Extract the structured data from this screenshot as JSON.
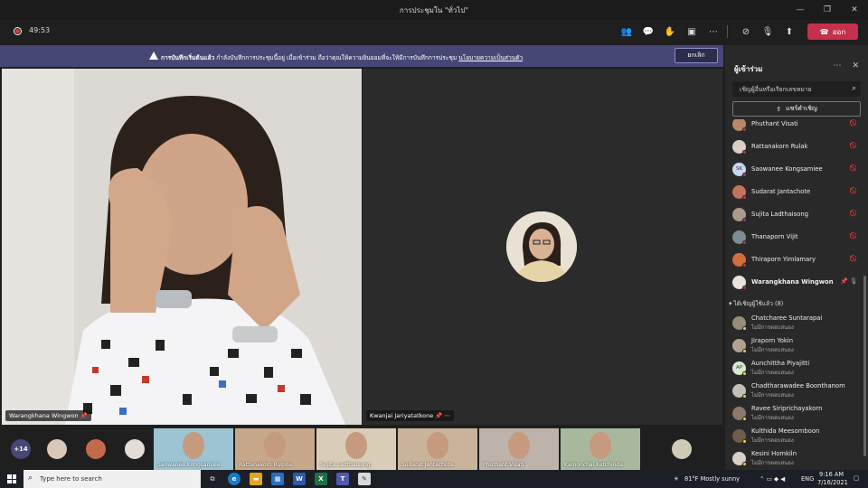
{
  "window": {
    "title": "การประชุมใน \"ทั่วไป\""
  },
  "toolbar": {
    "timer": "49:53",
    "leave_label": "ออก"
  },
  "banner": {
    "bold_text": "การบันทึกเริ่มต้นแล้ว",
    "text": " กำลังบันทึกการประชุมนี้อยู่ เมื่อเข้าร่วม ถือว่าคุณให้ความยินยอมที่จะให้มีการบันทึกการประชุม ",
    "link": "นโยบายความเป็นส่วนตัว",
    "dismiss_label": "ยกเลิก"
  },
  "stage": {
    "left_name": "Warangkhana Wingwon",
    "right_name": "Kwanjai Jariyatatkone"
  },
  "panel": {
    "title": "ผู้เข้าร่วม",
    "search_placeholder": "เชิญผู้อื่นหรือเรียกเลขหมาย",
    "share_label": "แชร์คำเชิญ",
    "participants": [
      {
        "name": "Phuthant Visati",
        "avatar": "#b98866"
      },
      {
        "name": "Rattanakorn Rulak",
        "avatar": "#d8cfc5"
      },
      {
        "name": "Saowanee Kongsamiee",
        "avatar": "#c8d8ef",
        "initials": "SK"
      },
      {
        "name": "Sudarat Jantachote",
        "avatar": "#c2745b"
      },
      {
        "name": "Sujita Ladthaisong",
        "avatar": "#a99a8a"
      },
      {
        "name": "Thanaporn Vijit",
        "avatar": "#7b8c95"
      },
      {
        "name": "Thiraporn Yimlamary",
        "avatar": "#d56e3e"
      },
      {
        "name": "Warangkhana Wingwon",
        "avatar": "#e8e2dc"
      }
    ],
    "invited_header": "ได้เชิญผู้ใช้แล้ว (8)",
    "invited": [
      {
        "name": "Chatcharee Suntarapai",
        "status": "ไม่มีการตอบสนอง",
        "avatar": "#9a8c7c"
      },
      {
        "name": "Jiraporn Yokin",
        "status": "ไม่มีการตอบสนอง",
        "avatar": "#b4a092"
      },
      {
        "name": "Aunchittha Piyajitti",
        "status": "ไม่มีการตอบสนอง",
        "avatar": "#d6e8d2",
        "initials": "AP"
      },
      {
        "name": "Chadtharawadee Boonthanom",
        "status": "ไม่มีการตอบสนอง",
        "avatar": "#c5bfb6"
      },
      {
        "name": "Ravee Siriprichayakorn",
        "status": "ไม่มีการตอบสนอง",
        "avatar": "#8c7a6a"
      },
      {
        "name": "Kulthida Meesomboon",
        "status": "ไม่มีการตอบสนอง",
        "avatar": "#6f5c4e"
      },
      {
        "name": "Kesini Homkiln",
        "status": "ไม่มีการตอบสนอง",
        "avatar": "#d9cfc4"
      }
    ]
  },
  "strip": {
    "more_label": "+14",
    "thumbs": [
      {
        "name": "Saowanee Kongsamiee",
        "bg": "#9cc4d2"
      },
      {
        "name": "Rattanakorn Rulpoa",
        "bg": "#c7a88a"
      },
      {
        "name": "Sujita Ladthaisong",
        "bg": "#d9cdb8"
      },
      {
        "name": "Sudarat Jantachote",
        "bg": "#c9b39a"
      },
      {
        "name": "Phuthant Visati",
        "bg": "#bdb3aa"
      },
      {
        "name": "Kamonchai Ketchinda",
        "bg": "#a8b89e"
      }
    ]
  },
  "taskbar": {
    "search_placeholder": "Type here to search",
    "weather": "81°F  Mostly sunny",
    "lang": "ENG",
    "time": "9:16 AM",
    "date": "7/16/2021"
  }
}
